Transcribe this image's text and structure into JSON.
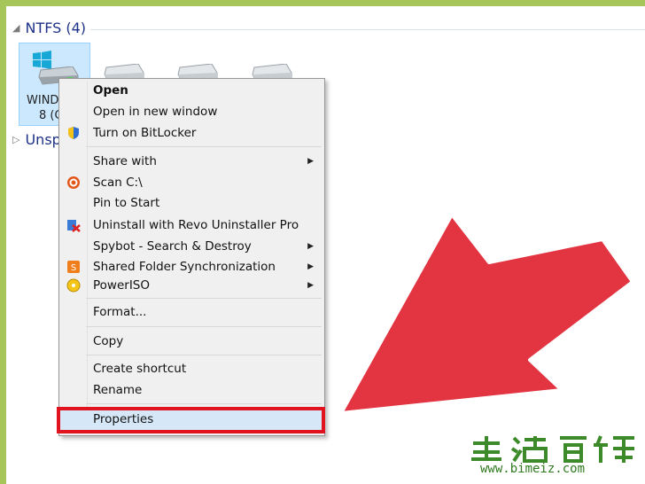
{
  "explorer": {
    "group_ntfs_label": "NTFS (4)",
    "group_unspecified_label": "Unsp",
    "drive_label_line1": "WIND",
    "drive_label_line2": "8 (C"
  },
  "context_menu": {
    "items": [
      {
        "label": "Open"
      },
      {
        "label": "Open in new window"
      },
      {
        "label": "Turn on BitLocker"
      },
      {
        "label": "Share with"
      },
      {
        "label": "Scan C:\\"
      },
      {
        "label": "Pin to Start"
      },
      {
        "label": "Uninstall with Revo Uninstaller Pro"
      },
      {
        "label": "Spybot - Search & Destroy"
      },
      {
        "label": "Shared Folder Synchronization"
      },
      {
        "label": "PowerISO"
      },
      {
        "label": "Format..."
      },
      {
        "label": "Copy"
      },
      {
        "label": "Create shortcut"
      },
      {
        "label": "Rename"
      },
      {
        "label": "Properties"
      }
    ],
    "submenu_arrow": "▶"
  },
  "colors": {
    "highlight_box": "#e0131f",
    "arrow_fill": "#e23441",
    "frame_green": "#a6c65a"
  },
  "watermark": {
    "url": "www.bimeiz.com"
  }
}
